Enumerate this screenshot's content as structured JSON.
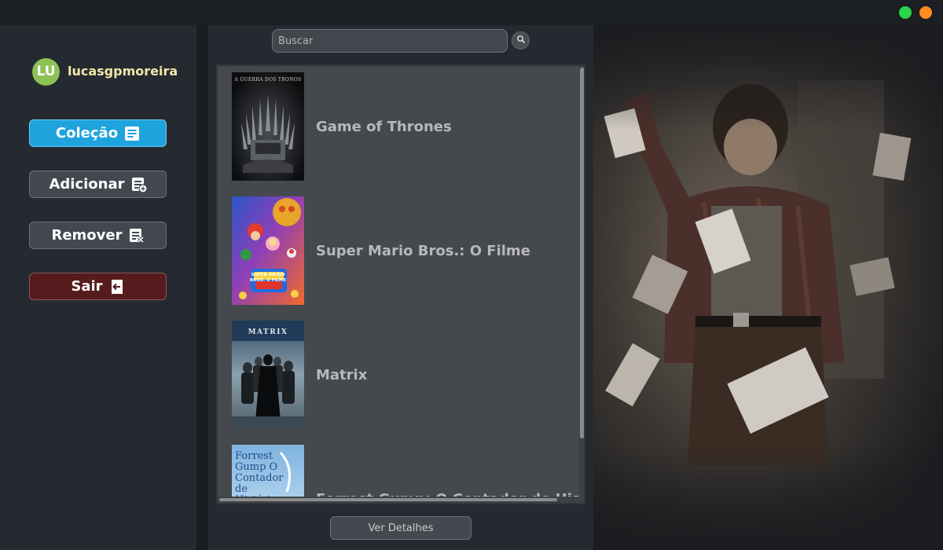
{
  "window": {
    "controls": [
      "maximize-green",
      "minimize-orange"
    ],
    "colors": {
      "green": "#28d74a",
      "orange": "#ff8a1e"
    }
  },
  "user": {
    "initials": "LU",
    "name": "lucasgpmoreira",
    "avatar_color": "#8dc255"
  },
  "sidebar": {
    "items": [
      {
        "label": "Coleção",
        "icon": "collection-list-icon",
        "active": true
      },
      {
        "label": "Adicionar",
        "icon": "add-to-list-icon"
      },
      {
        "label": "Remover",
        "icon": "remove-from-list-icon"
      },
      {
        "label": "Sair",
        "icon": "exit-icon"
      }
    ]
  },
  "search": {
    "placeholder": "Buscar",
    "button_icon": "search-icon"
  },
  "collection": {
    "items": [
      {
        "title": "Game of Thrones",
        "poster_text": "A GUERRA DOS TRONOS"
      },
      {
        "title": "Super Mario Bros.: O Filme",
        "poster_text": "SUPER MARIO BROS. O FILME"
      },
      {
        "title": "Matrix",
        "poster_text": "MATRIX"
      },
      {
        "title": "Forrest Gump: O Contador de Histórias",
        "poster_text": "Forrest Gump O Contador de Histórias"
      }
    ]
  },
  "actions": {
    "details_label": "Ver Detalhes"
  },
  "colors": {
    "accent": "#1fa3dd",
    "exit": "#561b1c",
    "panel": "#252a31",
    "list_bg": "#45484c"
  }
}
